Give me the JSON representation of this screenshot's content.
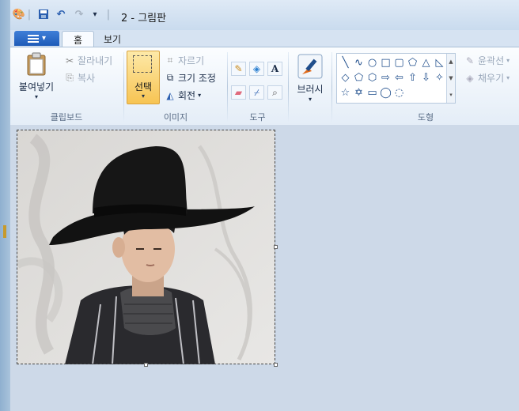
{
  "window": {
    "title": "2 - 그림판"
  },
  "quick_access": {
    "items": [
      {
        "name": "paint-app-icon",
        "glyph": "🎨"
      },
      {
        "name": "save-icon",
        "glyph": "💾"
      },
      {
        "name": "undo-icon",
        "glyph": "↶"
      },
      {
        "name": "redo-icon",
        "glyph": "↷"
      },
      {
        "name": "customize-qat-icon",
        "glyph": "▾"
      }
    ]
  },
  "tabs": {
    "home": "홈",
    "view": "보기"
  },
  "ribbon": {
    "clipboard": {
      "paste": "붙여넣기",
      "cut": "잘라내기",
      "copy": "복사",
      "label": "클립보드"
    },
    "image": {
      "select": "선택",
      "crop": "자르기",
      "resize": "크기 조정",
      "rotate": "회전",
      "label": "이미지"
    },
    "tools": {
      "label": "도구"
    },
    "brushes": {
      "label": "브러시"
    },
    "shapes": {
      "label": "도형",
      "outline": "윤곽선",
      "fill": "채우기",
      "glyphs": [
        "╲",
        "∿",
        "○",
        "□",
        "▢",
        "⬠",
        "△",
        "◺",
        "◇",
        "⬠",
        "⬡",
        "⇨",
        "⇦",
        "⇧",
        "⇩",
        "✧",
        "☆",
        "✡",
        "▭",
        "◯",
        "◌"
      ]
    }
  },
  "colors": {
    "accent": "#1e5bb8",
    "selected_button": "#f7c453",
    "ribbon_bg": "#e4edf7",
    "canvas_bg": "#cdd9e8"
  }
}
